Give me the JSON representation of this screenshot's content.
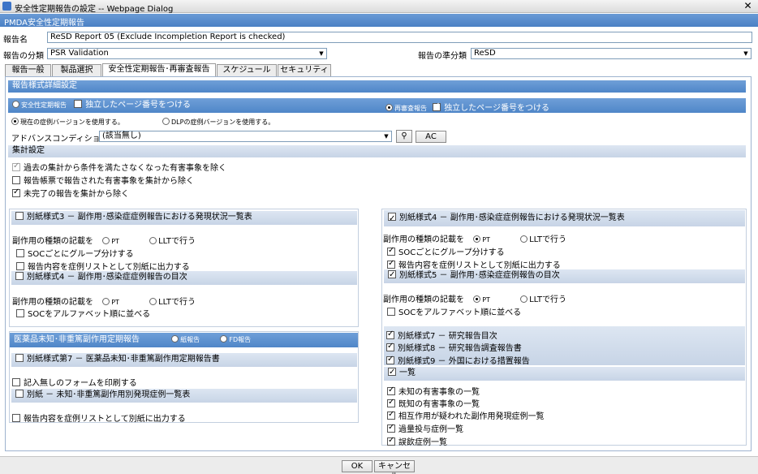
{
  "window": {
    "title": "安全性定期報告の設定 -- Webpage Dialog",
    "close": "✕"
  },
  "header": {
    "title": "PMDA安全性定期報告"
  },
  "report_name": {
    "label": "報告名",
    "value": "ReSD Report 05 (Exclude Incompletion Report is checked)"
  },
  "report_class": {
    "label": "報告の分類",
    "value": "PSR Validation"
  },
  "report_subclass": {
    "label": "報告の準分類",
    "value": "ReSD"
  },
  "tabs": [
    {
      "label": "報告一般"
    },
    {
      "label": "製品選択"
    },
    {
      "label": "安全性定期報告･再審査報告"
    },
    {
      "label": "スケジュール"
    },
    {
      "label": "セキュリティ"
    }
  ],
  "detail": {
    "title": "報告様式詳細設定",
    "safety_report": "安全性定期報告",
    "separate_page_a": "独立したページ番号をつける",
    "reexam_report": "再審査報告",
    "separate_page_b": "独立したページ番号をつける",
    "use_current_version": "現在の症例バージョンを使用する。",
    "use_dlp_version": "DLPの症例バージョンを使用する。",
    "advanced_label": "アドバンスコンディション",
    "advanced_value": "(該当無し)",
    "ac_button": "AC"
  },
  "aggregate": {
    "title": "集計設定",
    "items": [
      "過去の集計から条件を満たさなくなった有害事象を除く",
      "報告帳票で報告された有害事象を集計から除く",
      "未完了の報告を集計から除く"
    ]
  },
  "left": {
    "form3_title": "別紙様式3 － 副作用･感染症症例報告における発現状況一覧表",
    "form3_entry_label": "副作用の種類の記載を",
    "pt": "PT",
    "llt": "LLTで行う",
    "group_soc": "SOCごとにグループ分けする",
    "output_separate": "報告内容を症例リストとして別紙に出力する",
    "form4_title": "別紙様式4 － 副作用･感染症症例報告の目次",
    "form4_entry_label": "副作用の種類の記載を",
    "soc_alpha": "SOCをアルファベット順に並べる",
    "drug_title": "医薬品未知･非重篤副作用定期報告",
    "paper_report": "紙報告",
    "fd_report": "FD報告",
    "form7_title": "別紙様式第7 － 医薬品未知･非重篤副作用定期報告書",
    "print_blank": "記入無しのフォームを印刷する",
    "appendix_title": "別紙 － 未知･非重篤副作用別発現症例一覧表",
    "output_separate2": "報告内容を症例リストとして別紙に出力する"
  },
  "right": {
    "form4_title": "別紙様式4 － 副作用･感染症症例報告における発現状況一覧表",
    "entry_label": "副作用の種類の記載を",
    "pt": "PT",
    "llt": "LLTで行う",
    "group_soc": "SOCごとにグループ分けする",
    "output_separate": "報告内容を症例リストとして別紙に出力する",
    "form5_title": "別紙様式5 － 副作用･感染症症例報告の目次",
    "entry_label2": "副作用の種類の記載を",
    "soc_alpha": "SOCをアルファベット順に並べる",
    "form7": "別紙様式7 － 研究報告目次",
    "form8": "別紙様式8 － 研究報告調査報告書",
    "form9": "別紙様式9 － 外国における措置報告",
    "list_title": "一覧",
    "list_items": [
      "未知の有害事象の一覧",
      "既知の有害事象の一覧",
      "相互作用が疑われた副作用発現症例一覧",
      "過量投与症例一覧",
      "誤飲症例一覧"
    ]
  },
  "footer": {
    "ok": "OK",
    "cancel": "キャンセル"
  }
}
